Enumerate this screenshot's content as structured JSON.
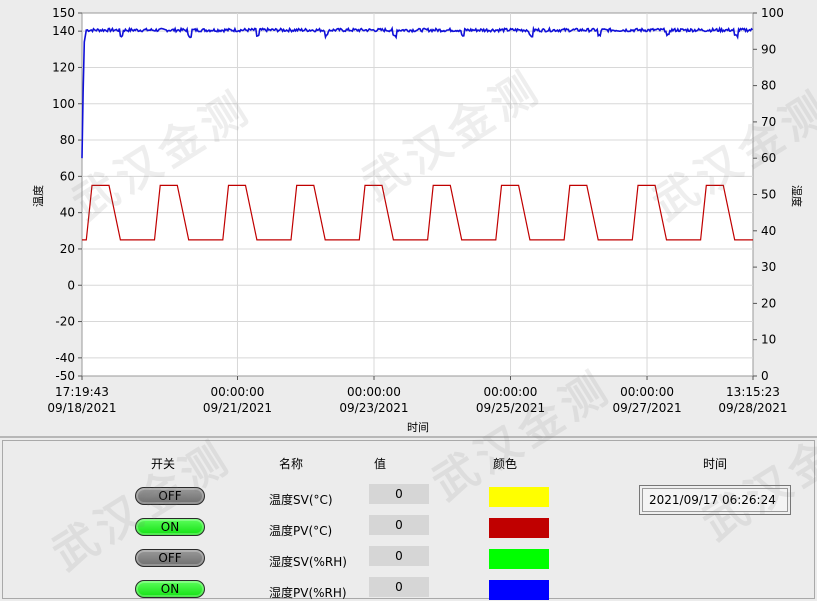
{
  "chart_data": {
    "type": "line",
    "xlabel": "时间",
    "ylabel_left": "温度",
    "ylabel_right": "湿度",
    "ylim_left": [
      -50,
      150
    ],
    "yticks_left": [
      150,
      140,
      120,
      100,
      80,
      60,
      40,
      20,
      0,
      -20,
      -40,
      -50
    ],
    "ylim_right": [
      0,
      100
    ],
    "yticks_right": [
      100,
      90,
      80,
      70,
      60,
      50,
      40,
      30,
      20,
      10,
      0
    ],
    "grid": true,
    "xticks": [
      {
        "time": "17:19:43",
        "date": "09/18/2021"
      },
      {
        "time": "00:00:00",
        "date": "09/21/2021"
      },
      {
        "time": "00:00:00",
        "date": "09/23/2021"
      },
      {
        "time": "00:00:00",
        "date": "09/25/2021"
      },
      {
        "time": "00:00:00",
        "date": "09/27/2021"
      },
      {
        "time": "13:15:23",
        "date": "09/28/2021"
      }
    ],
    "xtick_hours_from_start": [
      0,
      54.67,
      102.67,
      150.67,
      198.67,
      235.93
    ],
    "x_range_hours": [
      0,
      235.93
    ],
    "series": [
      {
        "name": "温度PV(°C)",
        "axis": "left",
        "color": "#c00000",
        "cycle_hours": 24,
        "low": 25,
        "high": 55,
        "points_hours": [
          0,
          1.5,
          3.5,
          9.5,
          13.5,
          19.5
        ]
      },
      {
        "name": "湿度PV(%RH)",
        "axis": "right",
        "color": "#1010d8",
        "startup": [
          [
            0,
            60
          ],
          [
            0.4,
            78
          ],
          [
            0.8,
            92
          ],
          [
            1.5,
            95.3
          ]
        ],
        "steady": 95.3
      }
    ]
  },
  "controls": {
    "headers": {
      "switch": "开关",
      "name": "名称",
      "value": "值",
      "color": "颜色",
      "time": "时间"
    },
    "rows": [
      {
        "state": "OFF",
        "name": "温度SV(°C)",
        "value": "0",
        "color": "#ffff00"
      },
      {
        "state": "ON",
        "name": "温度PV(°C)",
        "value": "0",
        "color": "#c00000"
      },
      {
        "state": "OFF",
        "name": "湿度SV(%RH)",
        "value": "0",
        "color": "#00ff00"
      },
      {
        "state": "ON",
        "name": "湿度PV(%RH)",
        "value": "0",
        "color": "#0000ff"
      }
    ],
    "time_value": "2021/09/17 06:26:24"
  },
  "watermark": "武汉金测"
}
